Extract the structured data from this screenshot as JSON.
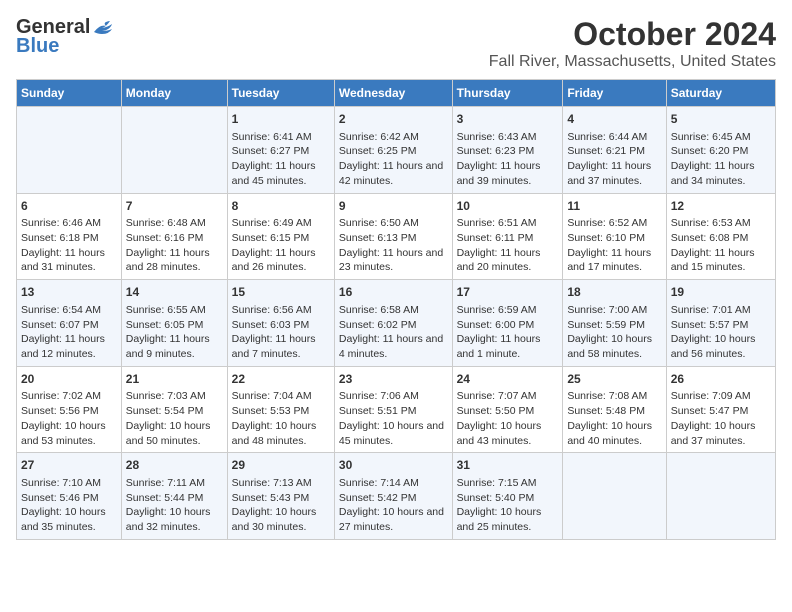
{
  "logo": {
    "line1": "General",
    "line2": "Blue"
  },
  "title": "October 2024",
  "subtitle": "Fall River, Massachusetts, United States",
  "headers": [
    "Sunday",
    "Monday",
    "Tuesday",
    "Wednesday",
    "Thursday",
    "Friday",
    "Saturday"
  ],
  "rows": [
    [
      {
        "day": "",
        "info": ""
      },
      {
        "day": "",
        "info": ""
      },
      {
        "day": "1",
        "info": "Sunrise: 6:41 AM\nSunset: 6:27 PM\nDaylight: 11 hours and 45 minutes."
      },
      {
        "day": "2",
        "info": "Sunrise: 6:42 AM\nSunset: 6:25 PM\nDaylight: 11 hours and 42 minutes."
      },
      {
        "day": "3",
        "info": "Sunrise: 6:43 AM\nSunset: 6:23 PM\nDaylight: 11 hours and 39 minutes."
      },
      {
        "day": "4",
        "info": "Sunrise: 6:44 AM\nSunset: 6:21 PM\nDaylight: 11 hours and 37 minutes."
      },
      {
        "day": "5",
        "info": "Sunrise: 6:45 AM\nSunset: 6:20 PM\nDaylight: 11 hours and 34 minutes."
      }
    ],
    [
      {
        "day": "6",
        "info": "Sunrise: 6:46 AM\nSunset: 6:18 PM\nDaylight: 11 hours and 31 minutes."
      },
      {
        "day": "7",
        "info": "Sunrise: 6:48 AM\nSunset: 6:16 PM\nDaylight: 11 hours and 28 minutes."
      },
      {
        "day": "8",
        "info": "Sunrise: 6:49 AM\nSunset: 6:15 PM\nDaylight: 11 hours and 26 minutes."
      },
      {
        "day": "9",
        "info": "Sunrise: 6:50 AM\nSunset: 6:13 PM\nDaylight: 11 hours and 23 minutes."
      },
      {
        "day": "10",
        "info": "Sunrise: 6:51 AM\nSunset: 6:11 PM\nDaylight: 11 hours and 20 minutes."
      },
      {
        "day": "11",
        "info": "Sunrise: 6:52 AM\nSunset: 6:10 PM\nDaylight: 11 hours and 17 minutes."
      },
      {
        "day": "12",
        "info": "Sunrise: 6:53 AM\nSunset: 6:08 PM\nDaylight: 11 hours and 15 minutes."
      }
    ],
    [
      {
        "day": "13",
        "info": "Sunrise: 6:54 AM\nSunset: 6:07 PM\nDaylight: 11 hours and 12 minutes."
      },
      {
        "day": "14",
        "info": "Sunrise: 6:55 AM\nSunset: 6:05 PM\nDaylight: 11 hours and 9 minutes."
      },
      {
        "day": "15",
        "info": "Sunrise: 6:56 AM\nSunset: 6:03 PM\nDaylight: 11 hours and 7 minutes."
      },
      {
        "day": "16",
        "info": "Sunrise: 6:58 AM\nSunset: 6:02 PM\nDaylight: 11 hours and 4 minutes."
      },
      {
        "day": "17",
        "info": "Sunrise: 6:59 AM\nSunset: 6:00 PM\nDaylight: 11 hours and 1 minute."
      },
      {
        "day": "18",
        "info": "Sunrise: 7:00 AM\nSunset: 5:59 PM\nDaylight: 10 hours and 58 minutes."
      },
      {
        "day": "19",
        "info": "Sunrise: 7:01 AM\nSunset: 5:57 PM\nDaylight: 10 hours and 56 minutes."
      }
    ],
    [
      {
        "day": "20",
        "info": "Sunrise: 7:02 AM\nSunset: 5:56 PM\nDaylight: 10 hours and 53 minutes."
      },
      {
        "day": "21",
        "info": "Sunrise: 7:03 AM\nSunset: 5:54 PM\nDaylight: 10 hours and 50 minutes."
      },
      {
        "day": "22",
        "info": "Sunrise: 7:04 AM\nSunset: 5:53 PM\nDaylight: 10 hours and 48 minutes."
      },
      {
        "day": "23",
        "info": "Sunrise: 7:06 AM\nSunset: 5:51 PM\nDaylight: 10 hours and 45 minutes."
      },
      {
        "day": "24",
        "info": "Sunrise: 7:07 AM\nSunset: 5:50 PM\nDaylight: 10 hours and 43 minutes."
      },
      {
        "day": "25",
        "info": "Sunrise: 7:08 AM\nSunset: 5:48 PM\nDaylight: 10 hours and 40 minutes."
      },
      {
        "day": "26",
        "info": "Sunrise: 7:09 AM\nSunset: 5:47 PM\nDaylight: 10 hours and 37 minutes."
      }
    ],
    [
      {
        "day": "27",
        "info": "Sunrise: 7:10 AM\nSunset: 5:46 PM\nDaylight: 10 hours and 35 minutes."
      },
      {
        "day": "28",
        "info": "Sunrise: 7:11 AM\nSunset: 5:44 PM\nDaylight: 10 hours and 32 minutes."
      },
      {
        "day": "29",
        "info": "Sunrise: 7:13 AM\nSunset: 5:43 PM\nDaylight: 10 hours and 30 minutes."
      },
      {
        "day": "30",
        "info": "Sunrise: 7:14 AM\nSunset: 5:42 PM\nDaylight: 10 hours and 27 minutes."
      },
      {
        "day": "31",
        "info": "Sunrise: 7:15 AM\nSunset: 5:40 PM\nDaylight: 10 hours and 25 minutes."
      },
      {
        "day": "",
        "info": ""
      },
      {
        "day": "",
        "info": ""
      }
    ]
  ]
}
